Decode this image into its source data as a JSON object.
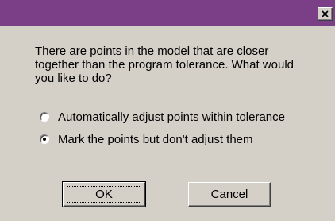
{
  "dialog": {
    "close_label": "×",
    "message_lines": [
      "There are points in the model that are closer",
      "together than the program tolerance. What would",
      "you like to do?"
    ],
    "options": [
      {
        "label": "Automatically adjust points within tolerance",
        "selected": false
      },
      {
        "label": "Mark the points but don't adjust them",
        "selected": true
      }
    ],
    "ok_label": "OK",
    "cancel_label": "Cancel"
  },
  "colors": {
    "titlebar": "#7a3f86",
    "face": "#d4d0c8"
  }
}
